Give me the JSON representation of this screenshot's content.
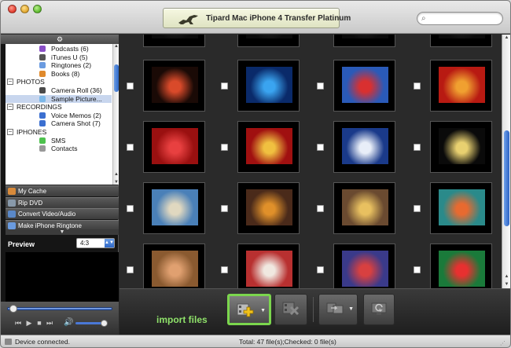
{
  "window": {
    "title": "Tipard Mac iPhone 4 Transfer Platinum"
  },
  "search": {
    "placeholder": ""
  },
  "tree": {
    "header_icon": "gear-icon",
    "rows": [
      {
        "label": "Podcasts (6)",
        "type": "item",
        "icon": "podcast-icon",
        "color": "#8a4fc7"
      },
      {
        "label": "iTunes U (5)",
        "type": "item",
        "icon": "graduation-cap-icon",
        "color": "#555555"
      },
      {
        "label": "Ringtones (2)",
        "type": "item",
        "icon": "bell-icon",
        "color": "#6a9be0"
      },
      {
        "label": "Books (8)",
        "type": "item",
        "icon": "book-icon",
        "color": "#e08a2c"
      },
      {
        "label": "PHOTOS",
        "type": "group",
        "toggle": "−"
      },
      {
        "label": "Camera Roll (36)",
        "type": "item",
        "icon": "camera-icon",
        "color": "#4a4a4a"
      },
      {
        "label": "Sample Picture...",
        "type": "item",
        "icon": "picture-icon",
        "color": "#7cb8e8",
        "selected": true
      },
      {
        "label": "RECORDINGS",
        "type": "group",
        "toggle": "−"
      },
      {
        "label": "Voice Memos (2)",
        "type": "item",
        "icon": "microphone-icon",
        "color": "#3b6fd0"
      },
      {
        "label": "Camera Shot (7)",
        "type": "item",
        "icon": "video-camera-icon",
        "color": "#3b6fd0"
      },
      {
        "label": "IPHONES",
        "type": "group",
        "toggle": "−"
      },
      {
        "label": "SMS",
        "type": "item",
        "icon": "sms-icon",
        "color": "#4ec24e"
      },
      {
        "label": "Contacts",
        "type": "item",
        "icon": "contacts-icon",
        "color": "#999999"
      }
    ]
  },
  "functions": [
    {
      "label": "My Cache",
      "icon": "cache-icon",
      "color": "#d88a3a"
    },
    {
      "label": "Rip DVD",
      "icon": "dvd-icon",
      "color": "#8899aa"
    },
    {
      "label": "Convert Video/Audio",
      "icon": "convert-icon",
      "color": "#5a88c8"
    },
    {
      "label": "Make iPhone Ringtone",
      "icon": "ringtone-icon",
      "color": "#6a9be0"
    }
  ],
  "preview": {
    "label": "Preview",
    "ratio": "4:3"
  },
  "player": {
    "progress": 0.02,
    "volume": 1.0
  },
  "thumbnails": [
    {
      "bg": "#0b0b0b",
      "fg": "#222"
    },
    {
      "bg": "#0b0b0b",
      "fg": "#222"
    },
    {
      "bg": "#0b0b0b",
      "fg": "#222"
    },
    {
      "bg": "#0b0b0b",
      "fg": "#222"
    },
    {
      "bg": "#1a0a06",
      "fg": "#d94a2a"
    },
    {
      "bg": "#0a2a6a",
      "fg": "#3aa4f0"
    },
    {
      "bg": "#2a5ab8",
      "fg": "#d93030"
    },
    {
      "bg": "#b81a12",
      "fg": "#f0a030"
    },
    {
      "bg": "#9a1010",
      "fg": "#e84040"
    },
    {
      "bg": "#a01010",
      "fg": "#f0c040"
    },
    {
      "bg": "#1a3a8a",
      "fg": "#e8eef8"
    },
    {
      "bg": "#0a0a0a",
      "fg": "#e8d070"
    },
    {
      "bg": "#4a80b8",
      "fg": "#e0d8c0"
    },
    {
      "bg": "#4a2a1a",
      "fg": "#e0902a"
    },
    {
      "bg": "#6a4a30",
      "fg": "#e8c060"
    },
    {
      "bg": "#2a8a8a",
      "fg": "#e86a30"
    },
    {
      "bg": "#8a5a30",
      "fg": "#e0a070"
    },
    {
      "bg": "#b83030",
      "fg": "#f0e8e0"
    },
    {
      "bg": "#3a3a8a",
      "fg": "#d84040"
    },
    {
      "bg": "#1a7a3a",
      "fg": "#e83030"
    }
  ],
  "toolbar": {
    "import_label": "import files",
    "buttons": [
      {
        "name": "import-files-button",
        "icon": "film-add-icon",
        "highlighted": true,
        "has_menu": true
      },
      {
        "name": "delete-button",
        "icon": "film-delete-icon",
        "highlighted": false,
        "has_menu": false
      },
      {
        "name": "export-button",
        "icon": "export-to-pc-icon",
        "highlighted": false,
        "has_menu": true
      },
      {
        "name": "export-to-itunes-button",
        "icon": "export-to-itunes-icon",
        "highlighted": false,
        "has_menu": false
      }
    ]
  },
  "status": {
    "left": "Device connected.",
    "middle": "Total: 47 file(s);Checked: 0 file(s)"
  },
  "colors": {
    "import_highlight": "#7bd64d",
    "selection": "#c8d6ee"
  }
}
